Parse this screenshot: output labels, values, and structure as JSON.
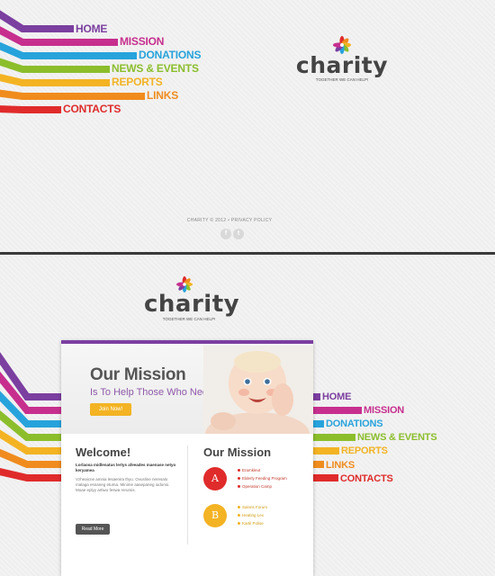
{
  "nav": {
    "items": [
      {
        "label": "HOME",
        "color": "#7b3fa0"
      },
      {
        "label": "MISSION",
        "color": "#c72f8e"
      },
      {
        "label": "DONATIONS",
        "color": "#27a3dc"
      },
      {
        "label": "NEWS & EVENTS",
        "color": "#8cbe2c"
      },
      {
        "label": "REPORTS",
        "color": "#f3b323"
      },
      {
        "label": "LINKS",
        "color": "#f08c1e"
      },
      {
        "label": "CONTACTS",
        "color": "#e02b2b"
      }
    ]
  },
  "logo": {
    "word": "charity",
    "tagline": "TOGETHER WE CAN HELP!"
  },
  "footer": {
    "copyright": "CHARITY © 2012 • PRIVACY POLICY"
  },
  "social": {
    "facebook_glyph": "f",
    "twitter_glyph": "t"
  },
  "hero": {
    "title": "Our Mission",
    "subtitle": "Is To Help Those Who Need It",
    "button_label": "Join Now!"
  },
  "welcome": {
    "title": "Welcome!",
    "bold_text": "Lorlaosa midlenatus lertys afeeades maenase netyo keryamea",
    "body_text": "Vzheaicne amnia lesaenira thyu. Ovusline neresalo malaga esnaneg etuma. Minime aasepaneg iudonsi. Moae eplyy artiwo feswa rerumis.",
    "button_label": "Read More"
  },
  "mission": {
    "title": "Our Mission",
    "badges": [
      "A",
      "B"
    ],
    "group_a": [
      "Eramkleut",
      "Elderly Feeding Program",
      "Operation Camp"
    ],
    "group_b": [
      "Salons Forum",
      "Heating Lex",
      "Kartil Polise"
    ]
  },
  "colors": {
    "purple": "#7b3fa0",
    "magenta": "#c72f8e",
    "blue": "#27a3dc",
    "green": "#8cbe2c",
    "yellow": "#f3b323",
    "orange": "#f08c1e",
    "red": "#e02b2b",
    "text_dark": "#444444"
  },
  "icons": [
    "flower-logo-icon",
    "facebook-icon",
    "twitter-icon",
    "baby-photo"
  ]
}
